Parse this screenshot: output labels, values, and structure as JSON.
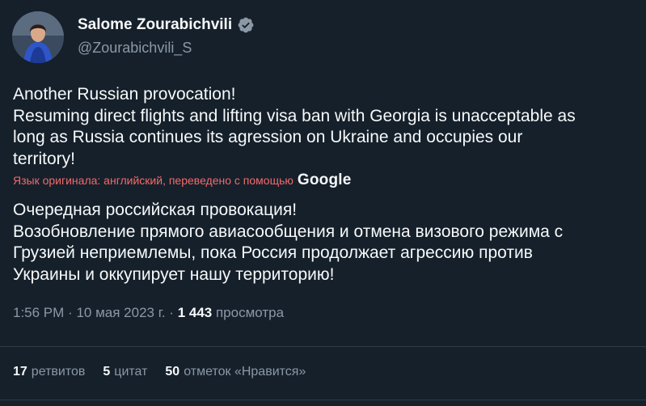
{
  "author": {
    "name": "Salome Zourabichvili",
    "handle": "@Zourabichvili_S",
    "verified_icon": "verified-badge-icon"
  },
  "tweet": {
    "original_lines": [
      "Another Russian provocation!",
      "Resuming direct flights and lifting visa ban with Georgia is unacceptable as",
      "long as Russia continues its agression on Ukraine and occupies our",
      "territory!"
    ],
    "translation_notice": "Язык оригинала: английский, переведено с помощью",
    "translation_provider": "Google",
    "translated_lines": [
      "Очередная российская провокация!",
      "Возобновление прямого авиасообщения и отмена визового режима с",
      "Грузией неприемлемы, пока Россия продолжает агрессию против",
      "Украины и оккупирует нашу территорию!"
    ]
  },
  "meta": {
    "time": "1:56 PM",
    "separator": "·",
    "date": "10 мая 2023 г.",
    "views_count": "1 443",
    "views_label": "просмотра"
  },
  "stats": {
    "retweets_count": "17",
    "retweets_label": "ретвитов",
    "quotes_count": "5",
    "quotes_label": "цитат",
    "likes_count": "50",
    "likes_label": "отметок «Нравится»"
  },
  "colors": {
    "background": "#15202b",
    "text": "#f7f9f9",
    "secondary": "#8b98a5",
    "verified": "#8b98a5",
    "translate_link": "#f36a6a"
  }
}
